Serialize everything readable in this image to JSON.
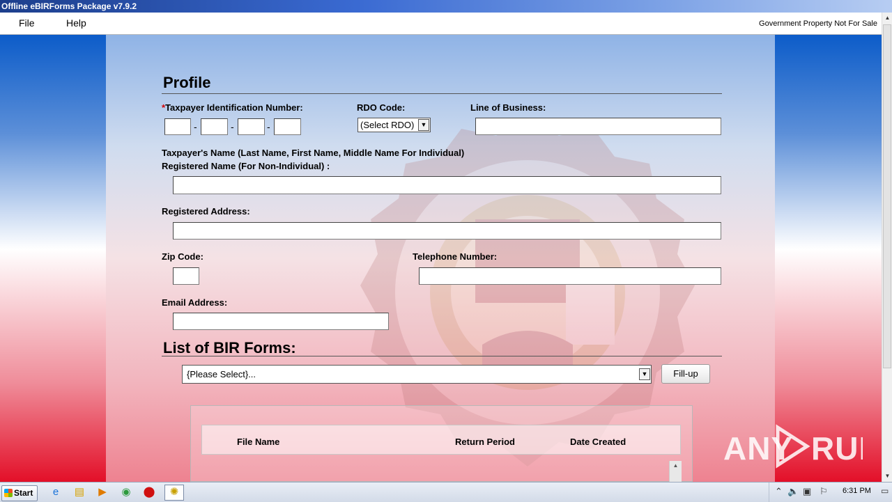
{
  "window": {
    "title": "Offline eBIRForms Package v7.9.2"
  },
  "menu": {
    "items": [
      "File",
      "Help"
    ],
    "notice": "Government Property Not For Sale"
  },
  "profile": {
    "title": "Profile",
    "tin_label": "Taxpayer Identification Number:",
    "required_mark": "*",
    "tin_separator": "-",
    "rdo_label": "RDO Code:",
    "rdo_value": "(Select RDO)",
    "lob_label": "Line of Business:",
    "name_label_1": "Taxpayer's Name (Last Name, First Name, Middle Name For Individual)",
    "name_label_2": "Registered Name (For Non-Individual) :",
    "address_label": "Registered Address:",
    "zip_label": "Zip Code:",
    "phone_label": "Telephone Number:",
    "email_label": "Email Address:"
  },
  "forms": {
    "title": "List of BIR Forms:",
    "select_value": "{Please Select}...",
    "fillup_label": "Fill-up",
    "columns": [
      "File Name",
      "Return Period",
      "Date Created"
    ]
  },
  "watermark": {
    "text": "ANY RUN"
  },
  "taskbar": {
    "start_label": "Start",
    "icons": [
      "ie-icon",
      "explorer-icon",
      "media-player-icon",
      "chrome-icon",
      "opera-icon",
      "ebirforms-icon"
    ],
    "clock": "6:31 PM"
  },
  "colors": {
    "titlebar": "#1c3e8c",
    "required": "#d10000",
    "top_gradient": "#0c5cc9",
    "bottom_gradient": "#e30f28"
  }
}
